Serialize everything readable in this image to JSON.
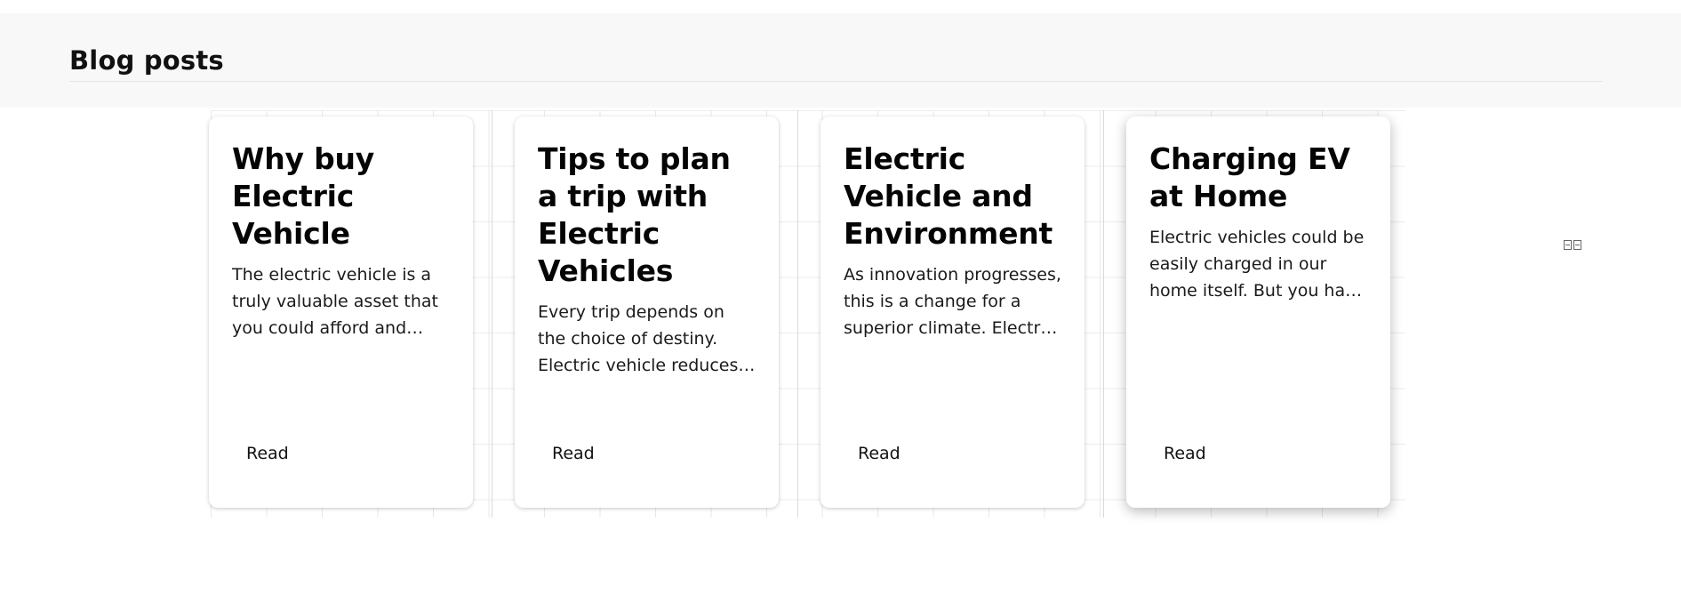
{
  "header": {
    "title": "Blog posts"
  },
  "posts": [
    {
      "title": "Why buy Electric Vehicle",
      "excerpt": "The electric vehicle is a truly valuable asset that you could afford and drive around the city.",
      "button_label": "Read"
    },
    {
      "title": "Tips to plan a trip with Electric Vehicles",
      "excerpt": "Every trip depends on the choice of destiny. Electric vehicle reduces your cost of travel.",
      "button_label": "Read"
    },
    {
      "title": "Electric Vehicle and Environment",
      "excerpt": "As innovation progresses, this is a change for a superior climate. Electric vehicles help.",
      "button_label": "Read"
    },
    {
      "title": "Charging EV at Home",
      "excerpt": "Electric vehicles could be easily charged in our home itself. But you have to plan ahead.",
      "button_label": "Read"
    }
  ],
  "widget": {
    "icon": "layout-grid-icon"
  }
}
